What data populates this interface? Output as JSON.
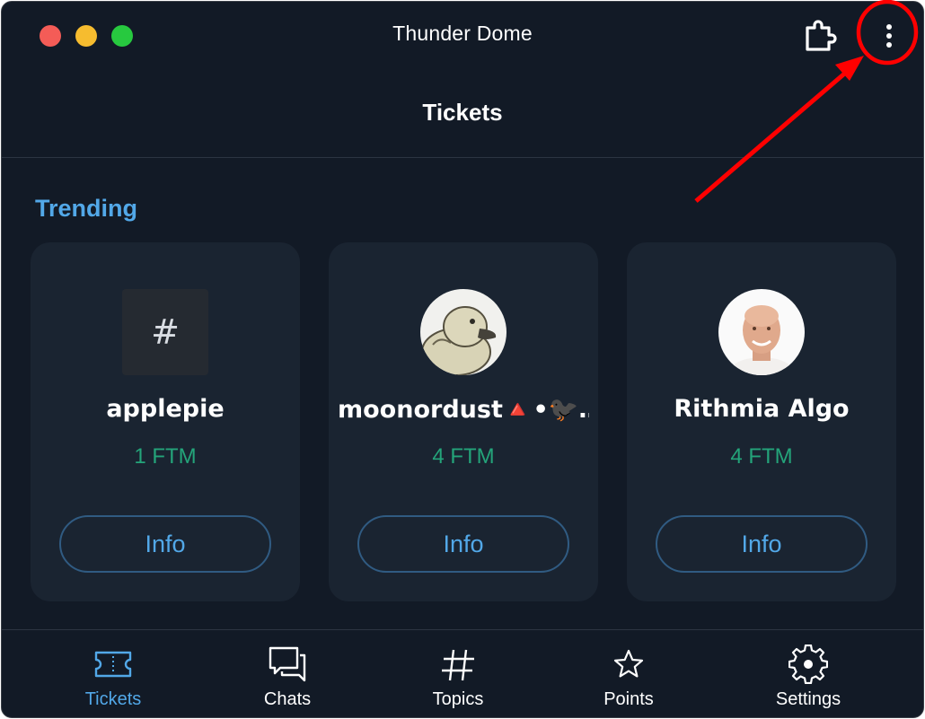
{
  "window": {
    "title": "Thunder Dome"
  },
  "header": {
    "title": "Tickets"
  },
  "trending": {
    "title": "Trending",
    "cards": [
      {
        "avatar": "hash-avatar",
        "avatar_text": "#",
        "name": "applepie",
        "price": "1 FTM",
        "button_label": "Info"
      },
      {
        "avatar": "duck-avatar",
        "name": "moonordust🔺•🐦‍⬛…",
        "price": "4 FTM",
        "button_label": "Info"
      },
      {
        "avatar": "person-avatar",
        "name": "Rithmia Algo",
        "price": "4 FTM",
        "button_label": "Info"
      }
    ]
  },
  "nav": {
    "active": "Tickets",
    "items": [
      {
        "label": "Tickets",
        "icon": "ticket-icon"
      },
      {
        "label": "Chats",
        "icon": "chats-icon"
      },
      {
        "label": "Topics",
        "icon": "hash-icon"
      },
      {
        "label": "Points",
        "icon": "star-icon"
      },
      {
        "label": "Settings",
        "icon": "gear-icon"
      }
    ]
  },
  "colors": {
    "background": "#121a26",
    "card": "#1a2431",
    "accent": "#52a8e8",
    "price": "#24a47a",
    "annotation": "#ff0000"
  }
}
